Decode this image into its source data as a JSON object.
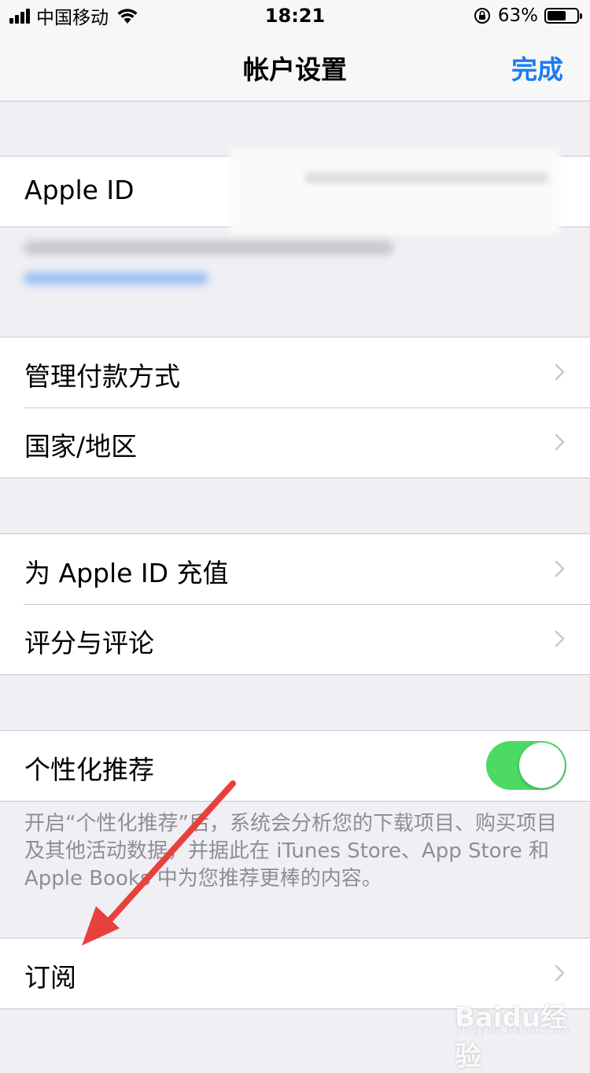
{
  "status_bar": {
    "carrier": "中国移动",
    "time": "18:21",
    "battery_percent_label": "63%",
    "battery_level": 0.63
  },
  "nav": {
    "title": "帐户设置",
    "done": "完成"
  },
  "apple_id": {
    "label": "Apple ID"
  },
  "group_payment": [
    {
      "label": "管理付款方式"
    },
    {
      "label": "国家/地区"
    }
  ],
  "group_topup": [
    {
      "label": "为 Apple ID 充值"
    },
    {
      "label": "评分与评论"
    }
  ],
  "personalized": {
    "label": "个性化推荐",
    "enabled": true,
    "footer": "开启“个性化推荐”后，系统会分析您的下载项目、购买项目及其他活动数据，并据此在 iTunes Store、App Store 和 Apple Books 中为您推荐更棒的内容。"
  },
  "subscriptions": {
    "label": "订阅"
  },
  "watermark": {
    "brand": "Baidu经验",
    "url": "jingyan.baidu.com"
  },
  "colors": {
    "accent": "#1a7cf0",
    "toggle_on": "#4cd964",
    "annotation_arrow": "#e8413d"
  }
}
